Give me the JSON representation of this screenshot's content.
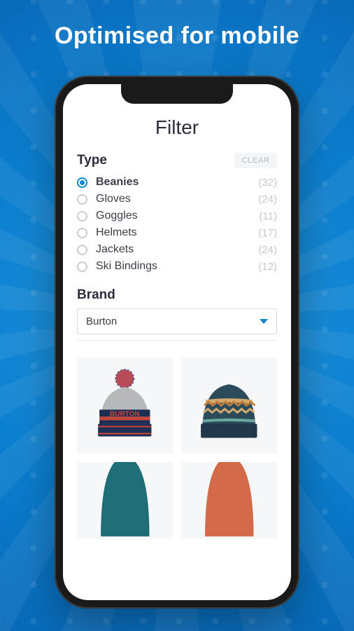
{
  "hero": "Optimised for mobile",
  "page_title": "Filter",
  "type_section": {
    "label": "Type",
    "clear_label": "CLEAR",
    "options": [
      {
        "label": "Beanies",
        "count": "(32)",
        "selected": true
      },
      {
        "label": "Gloves",
        "count": "(24)",
        "selected": false
      },
      {
        "label": "Goggles",
        "count": "(11)",
        "selected": false
      },
      {
        "label": "Helmets",
        "count": "(17)",
        "selected": false
      },
      {
        "label": "Jackets",
        "count": "(24)",
        "selected": false
      },
      {
        "label": "Ski Bindings",
        "count": "(12)",
        "selected": false
      }
    ]
  },
  "brand_section": {
    "label": "Brand",
    "selected": "Burton"
  },
  "products": [
    {
      "name": "burton-pom-beanie"
    },
    {
      "name": "burton-pattern-beanie"
    },
    {
      "name": "teal-beanie"
    },
    {
      "name": "orange-beanie"
    }
  ],
  "colors": {
    "accent": "#0e86d4"
  }
}
